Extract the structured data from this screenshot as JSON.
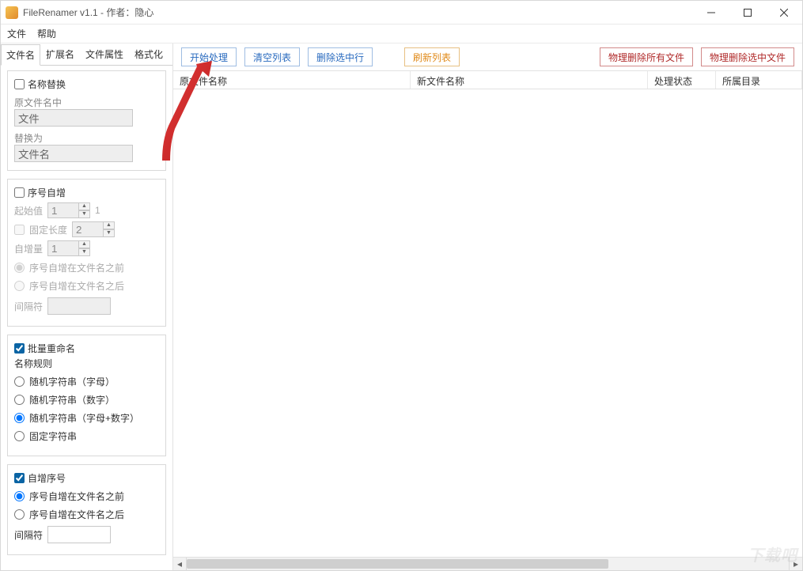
{
  "window": {
    "title": "FileRenamer v1.1 - 作者：隐心"
  },
  "menubar": {
    "file": "文件",
    "help": "帮助"
  },
  "tabs": {
    "filename": "文件名",
    "ext": "扩展名",
    "attr": "文件属性",
    "format": "格式化"
  },
  "toolbar": {
    "start": "开始处理",
    "clear": "清空列表",
    "delsel": "删除选中行",
    "refresh": "刷新列表",
    "phys_del_all": "物理删除所有文件",
    "phys_del_sel": "物理删除选中文件"
  },
  "table": {
    "col_orig": "原文件名称",
    "col_new": "新文件名称",
    "col_status": "处理状态",
    "col_dir": "所属目录"
  },
  "group_replace": {
    "title": "名称替换",
    "lbl_in": "原文件名中",
    "val_in": "文件",
    "lbl_to": "替换为",
    "val_to": "文件名"
  },
  "group_seq": {
    "title": "序号自增",
    "lbl_start": "起始值",
    "val_start": "1",
    "suffix_1": "1",
    "lbl_fixedlen": "固定长度",
    "val_fixedlen": "2",
    "lbl_step": "自增量",
    "val_step": "1",
    "opt_before": "序号自增在文件名之前",
    "opt_after": "序号自增在文件名之后",
    "lbl_sep": "间隔符"
  },
  "group_batch": {
    "title": "批量重命名",
    "lbl_rule": "名称规则",
    "opt_alpha": "随机字符串（字母）",
    "opt_num": "随机字符串（数字）",
    "opt_alnum": "随机字符串（字母+数字）",
    "opt_fixed": "固定字符串"
  },
  "group_auto": {
    "title": "自增序号",
    "opt_before": "序号自增在文件名之前",
    "opt_after": "序号自增在文件名之后",
    "lbl_sep": "间隔符"
  },
  "watermark": "下载吧"
}
